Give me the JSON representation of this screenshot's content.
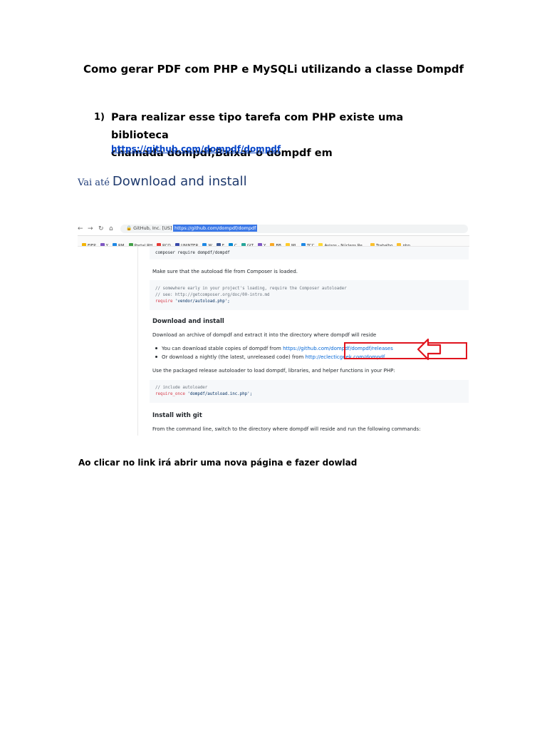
{
  "doc": {
    "title": "Como gerar PDF com PHP e MySQLi utilizando a classe  Dompdf",
    "item_number": "1)",
    "item_line1": "Para realizar esse tipo tarefa com PHP existe uma biblioteca",
    "item_line2": "chamada dompdf,Baixar o dompdf em",
    "item_link": "https://github.com/dompdf/dompdf",
    "vai_ate": "Vai até",
    "vai_target": "Download and install",
    "footer": "Ao clicar no link irá abrir uma nova página e fazer dowlad"
  },
  "browser": {
    "site_label": "GitHub, Inc. [US]",
    "url": "https://github.com/dompdf/dompdf",
    "bookmarks": [
      "FIEP",
      "Y",
      "RM",
      "Portal RH",
      "RCO",
      "UNINTER",
      "W",
      "F",
      "C",
      "GIT",
      "Y",
      "BB",
      "ML",
      "TCC",
      "Avisos - Núcleos Re...",
      "Trabalho",
      "php"
    ]
  },
  "readme": {
    "code1": "composer require dompdf/dompdf",
    "autoload_text": "Make sure that the autoload file from Composer is loaded.",
    "code2_line1": "// somewhere early in your project's loading, require the Composer autoloader",
    "code2_line2": "// see: http://getcomposer.org/doc/00-intro.md",
    "code2_kw": "require",
    "code2_str": "'vendor/autoload.php';",
    "heading_download": "Download and install",
    "download_text": "Download an archive of dompdf and extract it into the directory where dompdf will reside",
    "bullet1_prefix": "You can download stable copies of dompdf from",
    "bullet1_link": "https://github.com/dompdf/dompdf/releases",
    "bullet2_prefix": "Or download a nightly (the latest, unreleased code) from",
    "bullet2_link": "http://eclecticgeek.com/dompdf",
    "packaged_text": "Use the packaged release autoloader to load dompdf, libraries, and helper functions in your PHP:",
    "code3_line1": "// include autoloader",
    "code3_kw": "require_once",
    "code3_str": "'dompdf/autoload.inc.php';",
    "heading_git": "Install with git",
    "git_text": "From the command line, switch to the directory where dompdf will reside and run the following commands:"
  },
  "colors": {
    "link_blue": "#0645c9",
    "annotation_red": "#e0141e",
    "heading_navy": "#1f3d7a"
  }
}
